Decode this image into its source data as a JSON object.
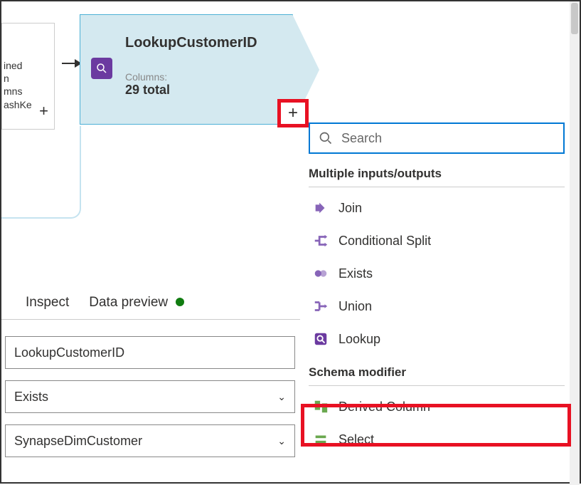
{
  "canvas": {
    "partial_node_lines": [
      "ined",
      "n",
      "mns",
      "ashKe"
    ],
    "lookup_node": {
      "title": "LookupCustomerID",
      "columns_label": "Columns:",
      "columns_value": "29 total"
    }
  },
  "dropdown": {
    "search": {
      "placeholder": "Search"
    },
    "sections": {
      "multiple": {
        "header": "Multiple inputs/outputs",
        "items": {
          "join": "Join",
          "conditional_split": "Conditional Split",
          "exists": "Exists",
          "union": "Union",
          "lookup": "Lookup"
        }
      },
      "schema": {
        "header": "Schema modifier",
        "items": {
          "derived_column": "Derived Column",
          "select": "Select"
        }
      }
    }
  },
  "tabs": {
    "inspect": "Inspect",
    "data_preview": "Data preview"
  },
  "form": {
    "stream_name": "LookupCustomerID",
    "select1": "Exists",
    "select2": "SynapseDimCustomer"
  },
  "colors": {
    "highlight": "#e81123",
    "primary": "#0078d4",
    "node_bg": "#d4e9f0",
    "purple": "#6b3aa0",
    "green": "#107c10"
  }
}
